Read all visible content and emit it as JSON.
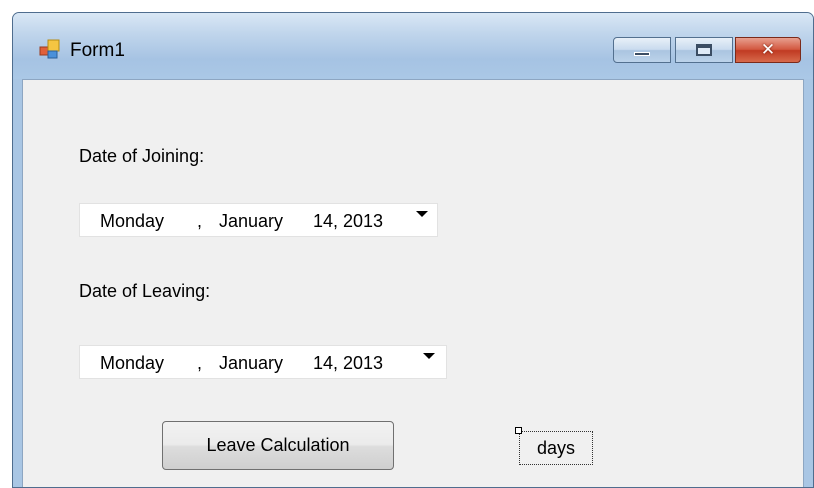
{
  "window": {
    "title": "Form1"
  },
  "form": {
    "joining_label": "Date of Joining:",
    "joining_date": {
      "weekday": "Monday",
      "sep": ",",
      "month": "January",
      "day_year": "14, 2013"
    },
    "leaving_label": "Date of Leaving:",
    "leaving_date": {
      "weekday": "Monday",
      "sep": ",",
      "month": "January",
      "day_year": "14, 2013"
    },
    "calc_button_label": "Leave Calculation",
    "days_label": "days"
  },
  "icons": {
    "app": "form-app-icon",
    "minimize": "minimize-icon",
    "maximize": "maximize-icon",
    "close": "close-icon",
    "dropdown": "chevron-down-icon"
  },
  "colors": {
    "titlebar": "#a9c6e4",
    "client_bg": "#f0f0f0",
    "close_button": "#c9472f"
  }
}
